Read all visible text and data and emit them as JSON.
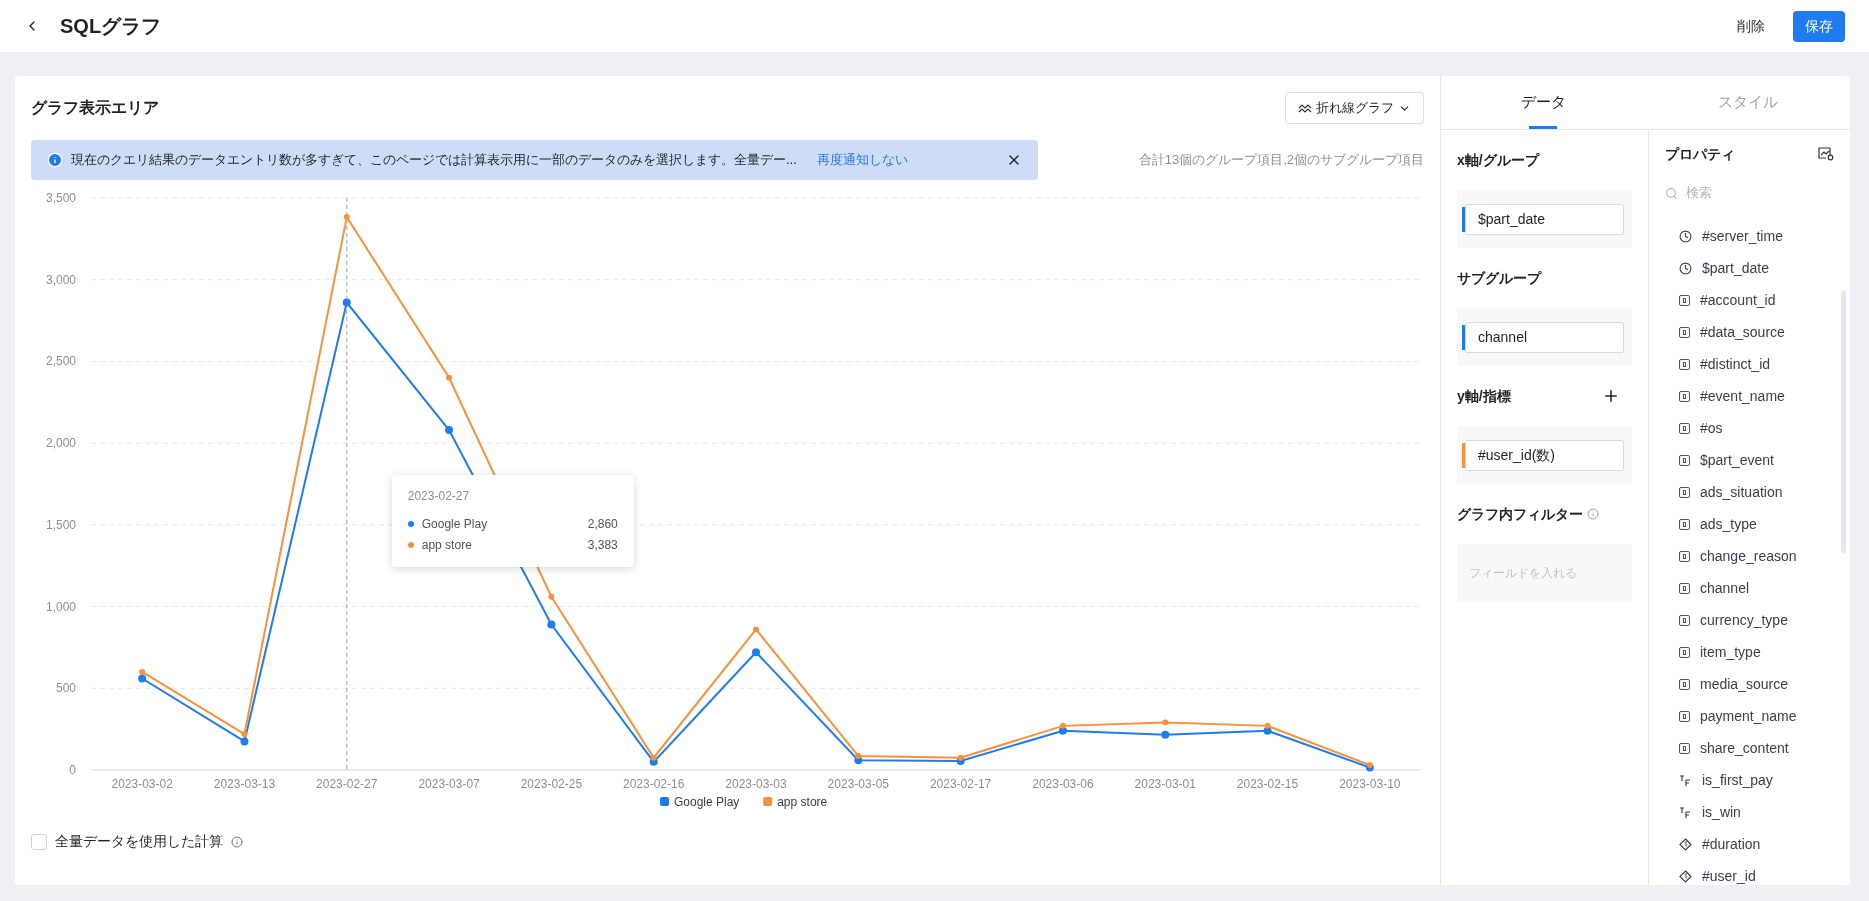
{
  "header": {
    "title": "SQLグラフ",
    "buttons": [
      {
        "label": "削除",
        "kind": "text"
      },
      {
        "label": "保存",
        "kind": "primary"
      }
    ]
  },
  "chart_panel": {
    "title": "グラフ表示エリア",
    "chart_type": "折れ線グラフ",
    "notice": {
      "text": "現在のクエリ結果のデータエントリ数が多すぎて、このページでは計算表示用に一部のデータのみを選択します。全量デー...",
      "link": "再度通知しない"
    },
    "summary": "合計13個のグループ項目,2個のサブグループ項目",
    "chart_data": {
      "type": "line",
      "categories": [
        "2023-03-02",
        "2023-03-13",
        "2023-02-27",
        "2023-03-07",
        "2023-02-25",
        "2023-02-16",
        "2023-03-03",
        "2023-03-05",
        "2023-02-17",
        "2023-03-06",
        "2023-03-01",
        "2023-02-15",
        "2023-03-10"
      ],
      "series": [
        {
          "name": "Google Play",
          "color": "#1f7cf0",
          "marker": "circle",
          "values": [
            560,
            175,
            2860,
            2080,
            890,
            50,
            720,
            60,
            55,
            240,
            215,
            240,
            15
          ]
        },
        {
          "name": "app store",
          "color": "#f7913d",
          "marker": "circle",
          "values": [
            600,
            220,
            3383,
            2400,
            1060,
            75,
            860,
            85,
            75,
            270,
            290,
            270,
            30
          ]
        }
      ],
      "grid": {
        "y": true
      },
      "legend": true,
      "ylim": [
        0,
        3500
      ],
      "yticks": [
        {
          "value": 0,
          "label": "0"
        },
        {
          "value": 500,
          "label": "500"
        },
        {
          "value": 1000,
          "label": "1,000"
        },
        {
          "value": 1500,
          "label": "1,500"
        },
        {
          "value": 2000,
          "label": "2,000"
        },
        {
          "value": 2500,
          "label": "2,500"
        },
        {
          "value": 3000,
          "label": "3,000"
        },
        {
          "value": 3500,
          "label": "3,500"
        }
      ],
      "ref_lines": [
        {
          "axis": "x",
          "value": "2023-02-27"
        }
      ]
    },
    "tooltip": {
      "date": "2023-02-27",
      "rows": [
        {
          "name": "Google Play",
          "value": "2,860",
          "color": "#1f7cf0"
        },
        {
          "name": "app store",
          "value": "3,383",
          "color": "#f7913d"
        }
      ]
    },
    "full_data_checkbox": {
      "label": "全量データを使用した計算",
      "checked": false
    }
  },
  "config_panel": {
    "tabs": [
      {
        "label": "データ",
        "selected": true
      },
      {
        "label": "スタイル",
        "selected": false
      }
    ],
    "sections": [
      {
        "kind": "plain",
        "title": "x軸/グループ",
        "field": "$part_date",
        "color": "#1f7cf0"
      },
      {
        "kind": "plain",
        "title": "サブグループ",
        "field": "channel",
        "color": "#1f7cf0"
      },
      {
        "kind": "add",
        "title": "y軸/指標",
        "field": "#user_id(数)",
        "color": "#f7913d"
      },
      {
        "kind": "info",
        "title": "グラフ内フィルター",
        "placeholder": "フィールドを入れる"
      }
    ],
    "properties": {
      "title": "プロパティ",
      "search_placeholder": "検索",
      "items": [
        {
          "kind": "time",
          "name": "#server_time"
        },
        {
          "kind": "time",
          "name": "$part_date"
        },
        {
          "kind": "string",
          "name": "#account_id"
        },
        {
          "kind": "string",
          "name": "#data_source"
        },
        {
          "kind": "string",
          "name": "#distinct_id"
        },
        {
          "kind": "string",
          "name": "#event_name"
        },
        {
          "kind": "string",
          "name": "#os"
        },
        {
          "kind": "string",
          "name": "$part_event"
        },
        {
          "kind": "string",
          "name": "ads_situation"
        },
        {
          "kind": "string",
          "name": "ads_type"
        },
        {
          "kind": "string",
          "name": "change_reason"
        },
        {
          "kind": "string",
          "name": "channel"
        },
        {
          "kind": "string",
          "name": "currency_type"
        },
        {
          "kind": "string",
          "name": "item_type"
        },
        {
          "kind": "string",
          "name": "media_source"
        },
        {
          "kind": "string",
          "name": "payment_name"
        },
        {
          "kind": "string",
          "name": "share_content"
        },
        {
          "kind": "bool",
          "name": "is_first_pay"
        },
        {
          "kind": "bool",
          "name": "is_win"
        },
        {
          "kind": "number",
          "name": "#duration"
        },
        {
          "kind": "number",
          "name": "#user_id"
        }
      ]
    }
  }
}
